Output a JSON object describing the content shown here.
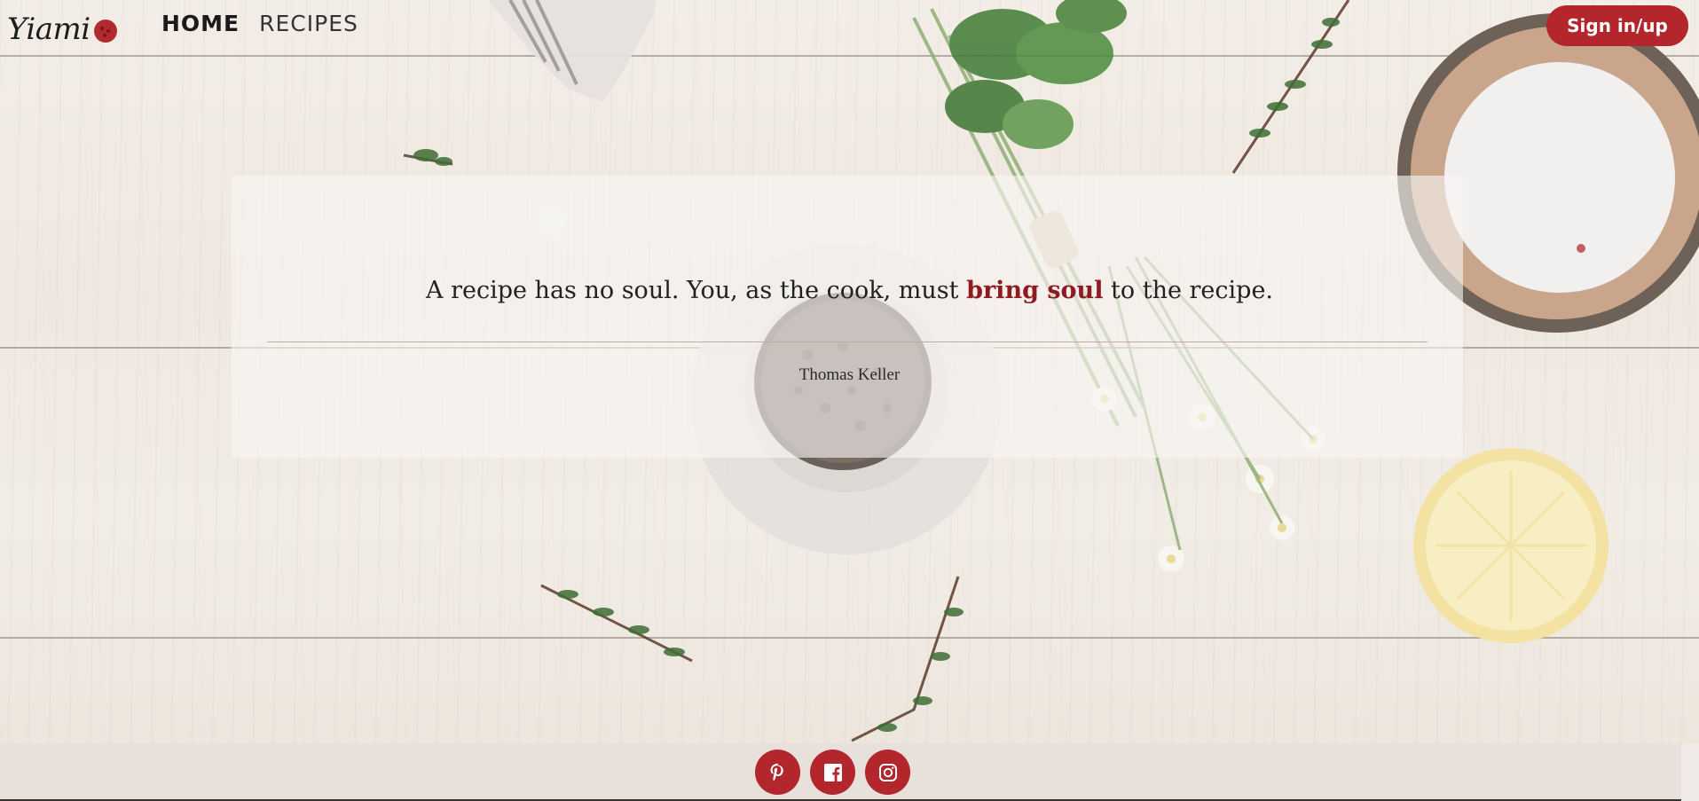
{
  "header": {
    "logo_text": "Yiami",
    "logo_icon": "cookie-icon",
    "nav": [
      {
        "label": "HOME",
        "active": true
      },
      {
        "label": "RECIPES",
        "active": false
      }
    ],
    "signin_label": "Sign in/up"
  },
  "quote": {
    "before": "A recipe has no soul. You, as the cook, must ",
    "highlight": "bring soul",
    "after": " to the recipe.",
    "author": "Thomas Keller"
  },
  "footer": {
    "socials": [
      {
        "name": "pinterest-icon"
      },
      {
        "name": "facebook-icon"
      },
      {
        "name": "instagram-icon"
      }
    ]
  },
  "colors": {
    "accent": "#b2262c",
    "highlight": "#8e1b22",
    "footer_bg": "#e8e1db"
  }
}
